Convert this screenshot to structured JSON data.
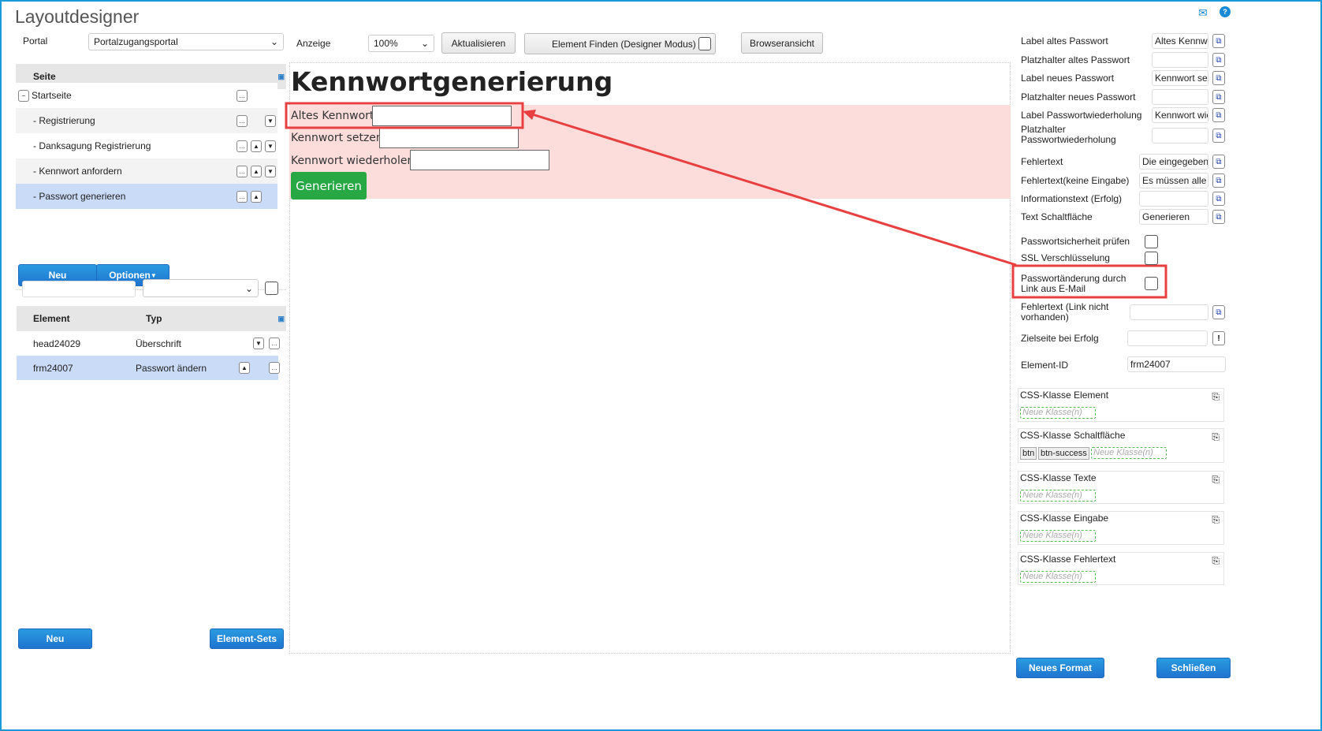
{
  "app": {
    "title": "Layoutdesigner",
    "icons": [
      "mail-icon",
      "help-icon"
    ]
  },
  "toolbar": {
    "portal_label": "Portal",
    "portal_value": "Portalzugangsportal",
    "anzeige_label": "Anzeige",
    "zoom_value": "100%",
    "refresh": "Aktualisieren",
    "find_element": "Element Finden (Designer Modus)",
    "browser_view": "Browseransicht"
  },
  "pages": {
    "header": "Seite",
    "items": [
      {
        "label": "Startseite"
      },
      {
        "label": "- Registrierung"
      },
      {
        "label": "- Danksagung Registrierung"
      },
      {
        "label": "- Kennwort anfordern"
      },
      {
        "label": "- Passwort generieren"
      }
    ],
    "new": "Neu",
    "options": "Optionen"
  },
  "elements": {
    "col_element": "Element",
    "col_type": "Typ",
    "rows": [
      {
        "element": "head24029",
        "type": "Überschrift"
      },
      {
        "element": "frm24007",
        "type": "Passwort ändern"
      }
    ],
    "new": "Neu",
    "element_sets": "Element-Sets"
  },
  "preview": {
    "heading": "Kennwortgenerierung",
    "old_pw": "Altes Kennwort",
    "new_pw": "Kennwort setzen",
    "repeat_pw": "Kennwort wiederholen",
    "button": "Generieren",
    "highlight": "#fddcdc",
    "button_color": "#28a745"
  },
  "props": {
    "rows": [
      {
        "label": "Label altes Passwort",
        "value": "Altes Kennwort"
      },
      {
        "label": "Platzhalter altes Passwort",
        "value": ""
      },
      {
        "label": "Label neues Passwort",
        "value": "Kennwort setzen"
      },
      {
        "label": "Platzhalter neues Passwort",
        "value": ""
      },
      {
        "label": "Label Passwortwiederholung",
        "value": "Kennwort wiederholen"
      },
      {
        "label": "Platzhalter Passwortwiederholung",
        "value": ""
      },
      {
        "label": "Fehlertext",
        "value": "Die eingegebenen"
      },
      {
        "label": "Fehlertext(keine Eingabe)",
        "value": "Es müssen alle F"
      },
      {
        "label": "Informationstext (Erfolg)",
        "value": ""
      },
      {
        "label": "Text Schaltfläche",
        "value": "Generieren"
      }
    ],
    "checks": [
      {
        "label": "Passwortsicherheit prüfen",
        "checked": false
      },
      {
        "label": "SSL Verschlüsselung",
        "checked": false
      },
      {
        "label": "Passwortänderung durch Link aus E-Mail",
        "checked": false
      }
    ],
    "link_error_label": "Fehlertext (Link nicht vorhanden)",
    "target_label": "Zielseite bei Erfolg",
    "id_label": "Element-ID",
    "id_value": "frm24007",
    "css": [
      {
        "label": "CSS-Klasse Element",
        "tags": []
      },
      {
        "label": "CSS-Klasse Schaltfläche",
        "tags": [
          "btn",
          "btn-success"
        ]
      },
      {
        "label": "CSS-Klasse Texte",
        "tags": []
      },
      {
        "label": "CSS-Klasse Eingabe",
        "tags": []
      },
      {
        "label": "CSS-Klasse Fehlertext",
        "tags": []
      }
    ],
    "new_class_placeholder": "Neue Klasse(n)"
  },
  "footer": {
    "new_format": "Neues Format",
    "close": "Schließen"
  }
}
